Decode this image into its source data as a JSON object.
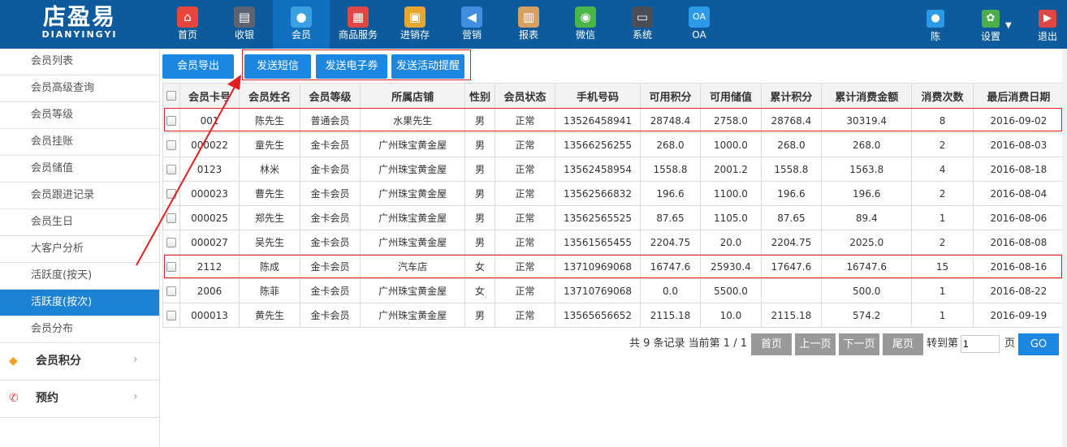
{
  "logo": {
    "main": "店盈易",
    "sub": "DIANYINGYI"
  },
  "nav": [
    {
      "label": "首页",
      "icon": "home-icon",
      "glyph": "⌂",
      "color": "#e8453c"
    },
    {
      "label": "收银",
      "icon": "cash-register-icon",
      "glyph": "▤",
      "color": "#5b6470"
    },
    {
      "label": "会员",
      "icon": "member-icon",
      "glyph": "●",
      "color": "#3aa0e0"
    },
    {
      "label": "商品服务",
      "icon": "product-icon",
      "glyph": "▦",
      "color": "#e04646"
    },
    {
      "label": "进销存",
      "icon": "inventory-icon",
      "glyph": "▣",
      "color": "#e8a630"
    },
    {
      "label": "营销",
      "icon": "megaphone-icon",
      "glyph": "◀",
      "color": "#3f8ee0"
    },
    {
      "label": "报表",
      "icon": "report-icon",
      "glyph": "▥",
      "color": "#d8a060"
    },
    {
      "label": "微信",
      "icon": "wechat-icon",
      "glyph": "◉",
      "color": "#49b649"
    },
    {
      "label": "系统",
      "icon": "monitor-icon",
      "glyph": "▭",
      "color": "#4a4f57"
    },
    {
      "label": "OA",
      "icon": "oa-icon",
      "glyph": "OA",
      "color": "#2b9be8"
    }
  ],
  "right_nav": [
    {
      "label": "陈",
      "icon": "user-icon",
      "glyph": "●",
      "color": "#2b9be8"
    },
    {
      "label": "设置",
      "icon": "gear-icon",
      "glyph": "✿",
      "color": "#4cae4c"
    },
    {
      "label": "退出",
      "icon": "logout-icon",
      "glyph": "▶",
      "color": "#e04646"
    }
  ],
  "settings_arrow": "▼",
  "sidebar": {
    "items": [
      "会员列表",
      "会员高级查询",
      "会员等级",
      "会员挂账",
      "会员储值",
      "会员跟进记录",
      "会员生日",
      "大客户分析",
      "活跃度(按天)",
      "活跃度(按次)",
      "会员分布"
    ],
    "groups": [
      {
        "label": "会员积分",
        "icon": "points-tag-icon",
        "glyph": "◆",
        "color": "#f0a020",
        "chevron": "›"
      },
      {
        "label": "预约",
        "icon": "phone-icon",
        "glyph": "✆",
        "color": "#e04646",
        "chevron": "›"
      }
    ]
  },
  "actions": [
    "会员导出",
    "发送短信",
    "发送电子券",
    "发送活动提醒"
  ],
  "table": {
    "headers": [
      "会员卡号",
      "会员姓名",
      "会员等级",
      "所属店铺",
      "性别",
      "会员状态",
      "手机号码",
      "可用积分",
      "可用储值",
      "累计积分",
      "累计消费金额",
      "消费次数",
      "最后消费日期"
    ],
    "rows": [
      [
        "001",
        "陈先生",
        "普通会员",
        "水果先生",
        "男",
        "正常",
        "13526458941",
        "28748.4",
        "2758.0",
        "28768.4",
        "30319.4",
        "8",
        "2016-09-02"
      ],
      [
        "000022",
        "童先生",
        "金卡会员",
        "广州珠宝黄金屋",
        "男",
        "正常",
        "13566256255",
        "268.0",
        "1000.0",
        "268.0",
        "268.0",
        "2",
        "2016-08-03"
      ],
      [
        "0123",
        "林米",
        "金卡会员",
        "广州珠宝黄金屋",
        "男",
        "正常",
        "13562458954",
        "1558.8",
        "2001.2",
        "1558.8",
        "1563.8",
        "4",
        "2016-08-18"
      ],
      [
        "000023",
        "曹先生",
        "金卡会员",
        "广州珠宝黄金屋",
        "男",
        "正常",
        "13562566832",
        "196.6",
        "1100.0",
        "196.6",
        "196.6",
        "2",
        "2016-08-04"
      ],
      [
        "000025",
        "郑先生",
        "金卡会员",
        "广州珠宝黄金屋",
        "男",
        "正常",
        "13562565525",
        "87.65",
        "1105.0",
        "87.65",
        "89.4",
        "1",
        "2016-08-06"
      ],
      [
        "000027",
        "吴先生",
        "金卡会员",
        "广州珠宝黄金屋",
        "男",
        "正常",
        "13561565455",
        "2204.75",
        "20.0",
        "2204.75",
        "2025.0",
        "2",
        "2016-08-08"
      ],
      [
        "2112",
        "陈成",
        "金卡会员",
        "汽车店",
        "女",
        "正常",
        "13710969068",
        "16747.6",
        "25930.4",
        "17647.6",
        "16747.6",
        "15",
        "2016-08-16"
      ],
      [
        "2006",
        "陈菲",
        "金卡会员",
        "广州珠宝黄金屋",
        "女",
        "正常",
        "13710769068",
        "0.0",
        "5500.0",
        "",
        "500.0",
        "1",
        "2016-08-22"
      ],
      [
        "000013",
        "黄先生",
        "金卡会员",
        "广州珠宝黄金屋",
        "男",
        "正常",
        "13565656652",
        "2115.18",
        "10.0",
        "2115.18",
        "574.2",
        "1",
        "2016-09-19"
      ]
    ]
  },
  "pager": {
    "summary": "共 9 条记录 当前第 1 / 1",
    "first": "首页",
    "prev": "上一页",
    "next": "下一页",
    "last": "尾页",
    "goto_label": "转到第",
    "page_value": "1",
    "page_unit": "页",
    "go": "GO"
  }
}
